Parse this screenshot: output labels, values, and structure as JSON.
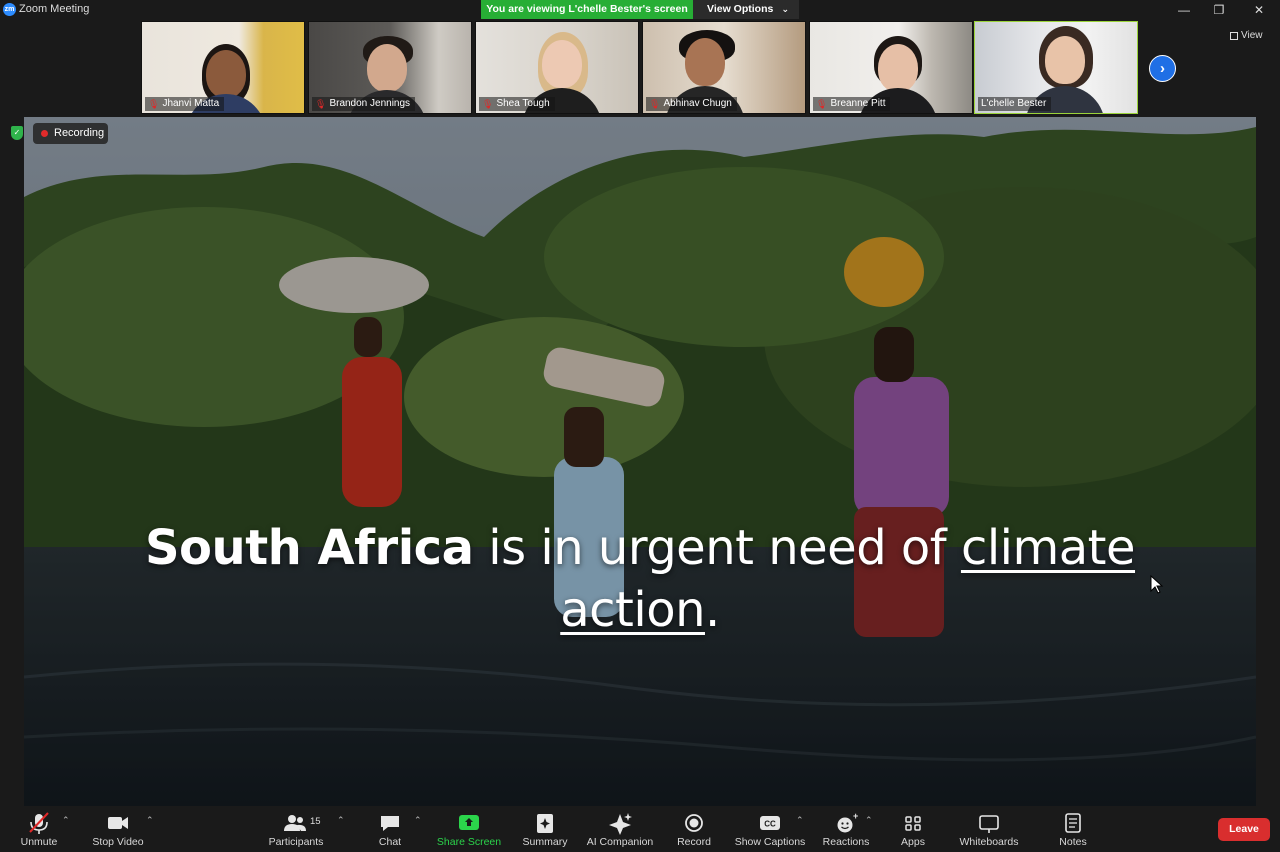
{
  "window": {
    "app_logo": "zm",
    "title": "Zoom Meeting",
    "controls": {
      "minimize": "—",
      "restore": "❐",
      "close": "✕"
    }
  },
  "banner": {
    "viewing_text": "You are viewing L'chelle Bester's screen",
    "view_options_label": "View Options",
    "view_options_chevron": "⌄"
  },
  "gallery": {
    "participants": [
      {
        "name": "Jhanvi Matta",
        "muted": true
      },
      {
        "name": "Brandon Jennings",
        "muted": true
      },
      {
        "name": "Shea Tough",
        "muted": true
      },
      {
        "name": "Abhinav Chugn",
        "muted": true
      },
      {
        "name": "Breanne Pitt",
        "muted": true
      },
      {
        "name": "L'chelle Bester",
        "muted": false,
        "active_speaker": true
      }
    ],
    "next_page_icon": "chevron-right-icon",
    "next_arrow_glyph": "›",
    "view_label": "View"
  },
  "recording": {
    "label": "Recording",
    "security_icon": "shield-check-icon",
    "shield_glyph": "✓"
  },
  "slide": {
    "bold_part": "South Africa",
    "middle_part": " is in urgent need of ",
    "underlined_1": "climate",
    "line2_underlined": "action",
    "line2_end": "."
  },
  "toolbar": {
    "unmute": "Unmute",
    "stop_video": "Stop Video",
    "participants": "Participants",
    "participants_count": "15",
    "chat": "Chat",
    "share_screen": "Share Screen",
    "summary": "Summary",
    "ai_companion": "AI Companion",
    "record": "Record",
    "show_captions": "Show Captions",
    "captions_badge": "CC",
    "reactions": "Reactions",
    "apps": "Apps",
    "whiteboards": "Whiteboards",
    "notes": "Notes",
    "leave": "Leave",
    "caret": "⌃"
  },
  "colors": {
    "share_banner": "#27ae35",
    "leave": "#d92e2e",
    "active_tile_border": "#9bd33a",
    "share_screen_icon": "#2bd44b",
    "recording_dot": "#e12b2b"
  }
}
